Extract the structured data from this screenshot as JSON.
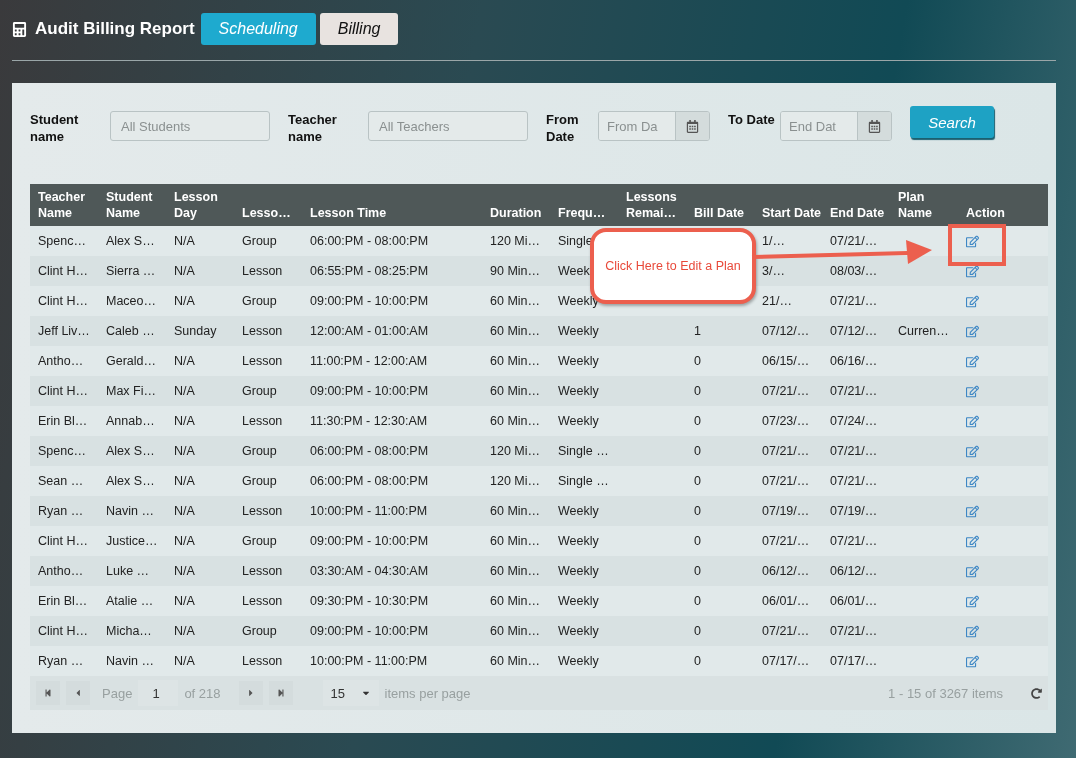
{
  "header": {
    "title": "Audit Billing Report",
    "tabs": [
      {
        "label": "Scheduling",
        "selected": true
      },
      {
        "label": "Billing",
        "selected": false
      }
    ]
  },
  "filters": [
    {
      "kind": "text",
      "label": "Student name",
      "placeholder": "All Students"
    },
    {
      "kind": "text",
      "label": "Teacher name",
      "placeholder": "All Teachers"
    },
    {
      "kind": "date",
      "label": "From Date",
      "placeholder": "From Da"
    },
    {
      "kind": "date",
      "label": "To Date",
      "placeholder": "End Dat"
    }
  ],
  "search_button": "Search",
  "table": {
    "columns": [
      "Teacher Name",
      "Student Name",
      "Lesson Day",
      "Lesso…",
      "Lesson Time",
      "Duration",
      "Frequ…",
      "Lessons Remai…",
      "Bill Date",
      "Start Date",
      "End Date",
      "Plan Name",
      "Action"
    ],
    "rows": [
      [
        "Spenc…",
        "Alex S…",
        "N/A",
        "Group",
        "06:00:PM - 08:00:PM",
        "120 Mi…",
        "Single",
        null,
        null,
        "1/…",
        "07/21/…",
        null
      ],
      [
        "Clint H…",
        "Sierra …",
        "N/A",
        "Lesson",
        "06:55:PM - 08:25:PM",
        "90 Min…",
        "Week",
        null,
        null,
        "3/…",
        "08/03/…",
        null
      ],
      [
        "Clint H…",
        "Maceo…",
        "N/A",
        "Group",
        "09:00:PM - 10:00:PM",
        "60 Min…",
        "Weekly",
        null,
        null,
        "21/…",
        "07/21/…",
        null
      ],
      [
        "Jeff Liv…",
        "Caleb …",
        "Sunday",
        "Lesson",
        "12:00:AM - 01:00:AM",
        "60 Min…",
        "Weekly",
        null,
        "1",
        "07/12/…",
        "07/12/…",
        "Curren…"
      ],
      [
        "Antho…",
        "Gerald…",
        "N/A",
        "Lesson",
        "11:00:PM - 12:00:AM",
        "60 Min…",
        "Weekly",
        null,
        "0",
        "06/15/…",
        "06/16/…",
        null
      ],
      [
        "Clint H…",
        "Max Fi…",
        "N/A",
        "Group",
        "09:00:PM - 10:00:PM",
        "60 Min…",
        "Weekly",
        null,
        "0",
        "07/21/…",
        "07/21/…",
        null
      ],
      [
        "Erin Bl…",
        "Annab…",
        "N/A",
        "Lesson",
        "11:30:PM - 12:30:AM",
        "60 Min…",
        "Weekly",
        null,
        "0",
        "07/23/…",
        "07/24/…",
        null
      ],
      [
        "Spenc…",
        "Alex S…",
        "N/A",
        "Group",
        "06:00:PM - 08:00:PM",
        "120 Mi…",
        "Single …",
        null,
        "0",
        "07/21/…",
        "07/21/…",
        null
      ],
      [
        "Sean …",
        "Alex S…",
        "N/A",
        "Group",
        "06:00:PM - 08:00:PM",
        "120 Mi…",
        "Single …",
        null,
        "0",
        "07/21/…",
        "07/21/…",
        null
      ],
      [
        "Ryan …",
        "Navin …",
        "N/A",
        "Lesson",
        "10:00:PM - 11:00:PM",
        "60 Min…",
        "Weekly",
        null,
        "0",
        "07/19/…",
        "07/19/…",
        null
      ],
      [
        "Clint H…",
        "Justice…",
        "N/A",
        "Group",
        "09:00:PM - 10:00:PM",
        "60 Min…",
        "Weekly",
        null,
        "0",
        "07/21/…",
        "07/21/…",
        null
      ],
      [
        "Antho…",
        "Luke …",
        "N/A",
        "Lesson",
        "03:30:AM - 04:30:AM",
        "60 Min…",
        "Weekly",
        null,
        "0",
        "06/12/…",
        "06/12/…",
        null
      ],
      [
        "Erin Bl…",
        "Atalie …",
        "N/A",
        "Lesson",
        "09:30:PM - 10:30:PM",
        "60 Min…",
        "Weekly",
        null,
        "0",
        "06/01/…",
        "06/01/…",
        null
      ],
      [
        "Clint H…",
        "Micha…",
        "N/A",
        "Group",
        "09:00:PM - 10:00:PM",
        "60 Min…",
        "Weekly",
        null,
        "0",
        "07/21/…",
        "07/21/…",
        null
      ],
      [
        "Ryan …",
        "Navin …",
        "N/A",
        "Lesson",
        "10:00:PM - 11:00:PM",
        "60 Min…",
        "Weekly",
        null,
        "0",
        "07/17/…",
        "07/17/…",
        null
      ]
    ]
  },
  "pager": {
    "page_label": "Page",
    "page": "1",
    "of_pages": "of 218",
    "page_size": "15",
    "per_page_label": "items per page",
    "summary": "1 - 15 of 3267 items"
  },
  "callout": {
    "text": "Click Here to Edit a Plan"
  }
}
